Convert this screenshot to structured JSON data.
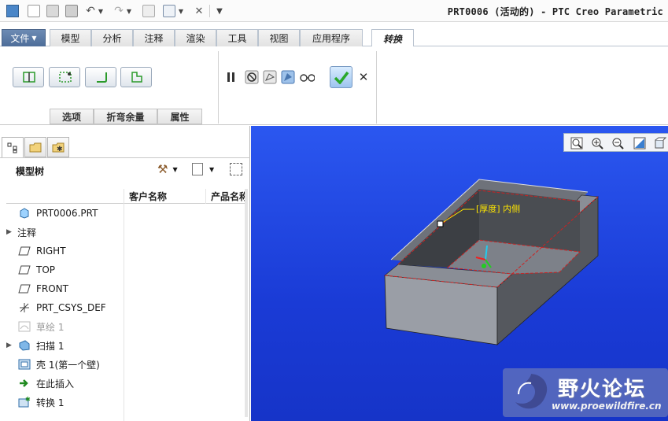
{
  "window": {
    "title": "PRT0006 (活动的) - PTC Creo Parametric"
  },
  "ribbon": {
    "tabs": [
      "文件",
      "模型",
      "分析",
      "注释",
      "渲染",
      "工具",
      "视图",
      "应用程序",
      "转换"
    ],
    "active_tab": "转换",
    "subtabs": [
      "选项",
      "折弯余量",
      "属性"
    ]
  },
  "model_tree": {
    "title": "模型树",
    "columns": [
      "客户名称",
      "产品名称"
    ],
    "items": [
      {
        "label": "PRT0006.PRT",
        "icon": "part-icon",
        "expand": false,
        "dim": false
      },
      {
        "label": "注释",
        "icon": "none",
        "expand": true,
        "dim": false
      },
      {
        "label": "RIGHT",
        "icon": "datum-plane-icon",
        "expand": false,
        "dim": false
      },
      {
        "label": "TOP",
        "icon": "datum-plane-icon",
        "expand": false,
        "dim": false
      },
      {
        "label": "FRONT",
        "icon": "datum-plane-icon",
        "expand": false,
        "dim": false
      },
      {
        "label": "PRT_CSYS_DEF",
        "icon": "csys-icon",
        "expand": false,
        "dim": false
      },
      {
        "label": "草绘 1",
        "icon": "sketch-icon",
        "expand": false,
        "dim": true
      },
      {
        "label": "扫描 1",
        "icon": "sweep-icon",
        "expand": true,
        "dim": false
      },
      {
        "label": "壳 1(第一个壁)",
        "icon": "shell-icon",
        "expand": false,
        "dim": false
      },
      {
        "label": "在此插入",
        "icon": "insert-arrow-icon",
        "expand": false,
        "dim": false
      },
      {
        "label": "转换 1",
        "icon": "convert-icon",
        "expand": false,
        "dim": false
      }
    ]
  },
  "viewport": {
    "annotation": "[厚度] 内侧",
    "watermark_text": "野火论坛",
    "watermark_url": "www.proewildfire.cn"
  },
  "colors": {
    "accent": "#2b57f0",
    "ok_green": "#2aa82a"
  }
}
